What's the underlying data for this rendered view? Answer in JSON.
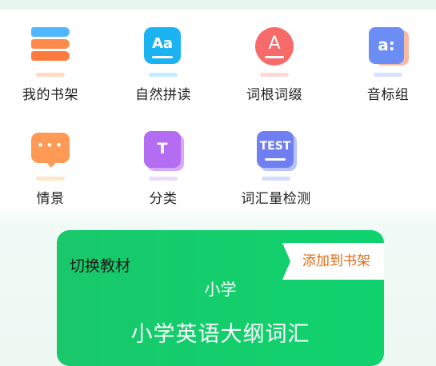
{
  "menu": {
    "row1": [
      {
        "label": "我的书架",
        "icon": "bookshelf-icon"
      },
      {
        "label": "自然拼读",
        "icon": "phonics-icon",
        "glyph": "Aa"
      },
      {
        "label": "词根词缀",
        "icon": "word-root-icon",
        "glyph": "A"
      },
      {
        "label": "音标组",
        "icon": "phonetic-icon",
        "glyph": "a:"
      }
    ],
    "row2": [
      {
        "label": "情景",
        "icon": "scene-chat-icon",
        "glyph": "•••"
      },
      {
        "label": "分类",
        "icon": "category-icon",
        "glyph": "T"
      },
      {
        "label": "词汇量检测",
        "icon": "vocab-test-icon",
        "glyph": "TEST"
      }
    ]
  },
  "card": {
    "switch_label": "切换教材",
    "add_label": "添加到书架",
    "level": "小学",
    "title": "小学英语大纲词汇"
  },
  "colors": {
    "card_green": "#14cc6c",
    "add_text": "#e26a15",
    "phonics_blue": "#1cb3f2",
    "root_red": "#f76a6a",
    "phonetic_blue": "#6c8ef4",
    "scene_orange": "#ff9a56",
    "category_purple": "#b36cf2",
    "test_blue": "#6f7ff2"
  }
}
